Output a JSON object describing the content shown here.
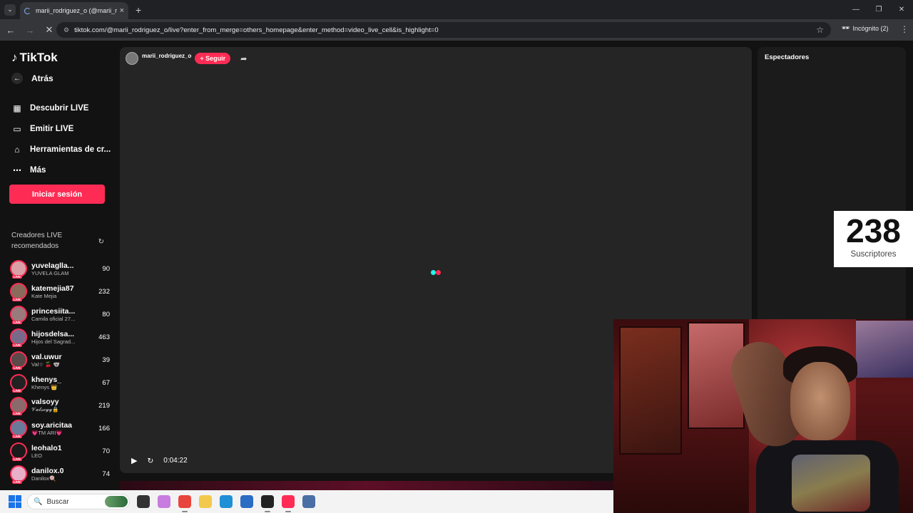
{
  "browser": {
    "tab_title": "marii_rodriguez_o (@marii_rodr",
    "tab_close": "×",
    "new_tab": "+",
    "url": "tiktok.com/@marii_rodriguez_o/live?enter_from_merge=others_homepage&enter_method=video_live_cell&is_highlight=0",
    "incognito_label": "Incógnito (2)"
  },
  "sidebar": {
    "logo": "TikTok",
    "back_label": "Atrás",
    "nav": [
      {
        "label": "Descubrir LIVE",
        "icon": "calendar-icon"
      },
      {
        "label": "Emitir LIVE",
        "icon": "video-camera-icon"
      },
      {
        "label": "Herramientas de cr...",
        "icon": "house-icon"
      },
      {
        "label": "Más",
        "icon": "more-icon"
      }
    ],
    "login_label": "Iniciar sesión",
    "creators_heading": "Creadores LIVE recomendados",
    "live_badge": "LIVE",
    "creators": [
      {
        "name": "yuvelaglla...",
        "sub": "YUVELA GLAM",
        "count": "90",
        "color": "#d9a1a6"
      },
      {
        "name": "katemejia87",
        "sub": "Kate Mejia",
        "count": "232",
        "color": "#8a6a5a"
      },
      {
        "name": "princesiita...",
        "sub": "Camila oficial 27...",
        "count": "80",
        "color": "#9a7a7a"
      },
      {
        "name": "hijosdelsa...",
        "sub": "Hijos del Sagrad...",
        "count": "463",
        "color": "#7a6a8a"
      },
      {
        "name": "val.uwur",
        "sub": "Val☆ 🍒 🐨",
        "count": "39",
        "color": "#5a4a4a"
      },
      {
        "name": "khenys_",
        "sub": "Khenys 👑",
        "count": "67",
        "color": "#222222"
      },
      {
        "name": "valsoyy",
        "sub": "𝓥𝓪𝓵𝓼𝓸𝔂𝔂🔒",
        "count": "219",
        "color": "#8a6a6a"
      },
      {
        "name": "soy.aricitaa",
        "sub": "💗TM ARI💗",
        "count": "166",
        "color": "#6a7a9a"
      },
      {
        "name": "leohalo1",
        "sub": "LEO",
        "count": "70",
        "color": "#1a1a1a"
      },
      {
        "name": "danilox.0",
        "sub": "Danilox🍭",
        "count": "74",
        "color": "#e8b0c8"
      }
    ]
  },
  "stream": {
    "host_name": "marii_rodriguez_o",
    "follow_label": "+ Seguir",
    "time": "0:04:22",
    "viewers_title": "Espectadores"
  },
  "overlay": {
    "subscribers_count": "238",
    "subscribers_label": "Suscriptores"
  },
  "taskbar": {
    "search_placeholder": "Buscar",
    "apps": [
      {
        "name": "task-view-icon",
        "color": "#333333"
      },
      {
        "name": "copilot-icon",
        "color": "#c77ddf"
      },
      {
        "name": "chrome-icon",
        "color": "#e8453c",
        "active": true
      },
      {
        "name": "file-explorer-icon",
        "color": "#f2c94c"
      },
      {
        "name": "edge-icon",
        "color": "#1f8fd6"
      },
      {
        "name": "microsoft-store-icon",
        "color": "#2b6cc4"
      },
      {
        "name": "obs-icon",
        "color": "#222222",
        "active": true
      },
      {
        "name": "tiktok-app-icon",
        "color": "#fe2c55",
        "active": true
      },
      {
        "name": "calculator-icon",
        "color": "#4a6fa5"
      }
    ]
  },
  "colors": {
    "accent": "#fe2c55",
    "loader_cyan": "#25f4ee",
    "loader_pink": "#fe2c55"
  }
}
